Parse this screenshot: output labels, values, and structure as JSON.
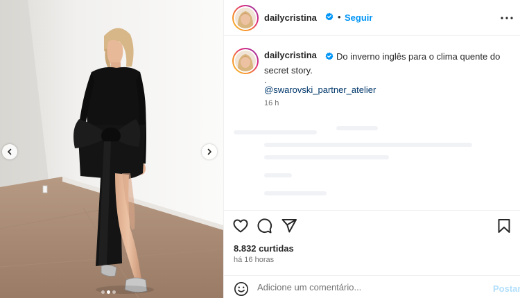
{
  "header": {
    "username": "dailycristina",
    "separator": "•",
    "follow_label": "Seguir",
    "verified_icon": "verified-badge-icon",
    "more_icon": "more-options-icon"
  },
  "caption": {
    "username": "dailycristina",
    "text": "Do inverno inglês para o clima quente do secret story.",
    "dot_line": ".",
    "mention": "@swarovski_partner_atelier",
    "time": "16 h"
  },
  "carousel": {
    "slide_count": 3,
    "active_slide": 2,
    "prev_icon": "chevron-left-icon",
    "next_icon": "chevron-right-icon"
  },
  "actions": {
    "like_icon": "heart-icon",
    "comment_icon": "comment-bubble-icon",
    "share_icon": "paper-plane-icon",
    "save_icon": "bookmark-icon"
  },
  "stats": {
    "likes": "8.832 curtidas",
    "posted": "há 16 horas"
  },
  "comment": {
    "placeholder": "Adicione um comentário...",
    "post_label": "Postar",
    "emoji_icon": "smiley-icon"
  },
  "colors": {
    "accent": "#0095f6",
    "mention": "#00376b",
    "post_disabled": "#b2dffc",
    "muted": "#737373"
  }
}
